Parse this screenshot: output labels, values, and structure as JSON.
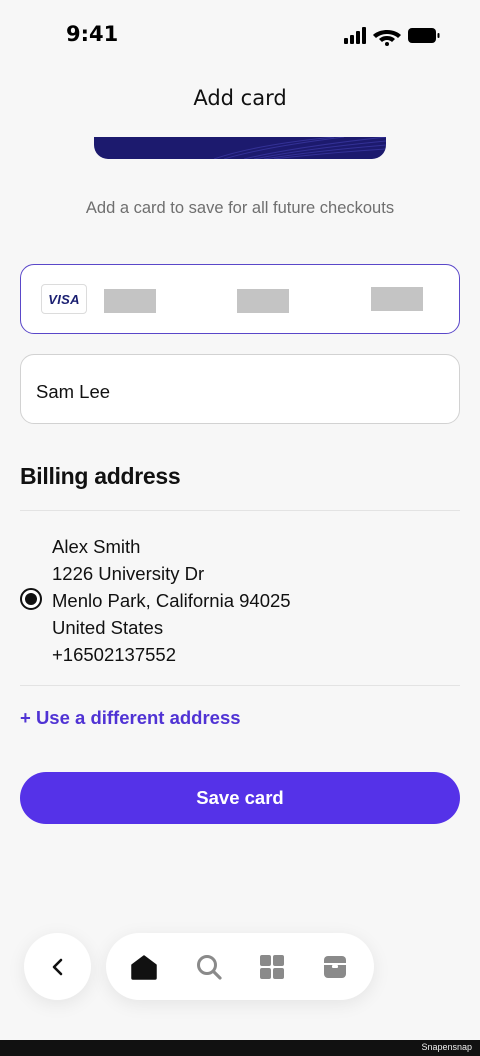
{
  "status_bar": {
    "time": "9:41"
  },
  "header": {
    "title": "Add card"
  },
  "subtitle": "Add a card to save for all future checkouts",
  "card_field": {
    "brand": "VISA"
  },
  "name_field": {
    "value": "Sam Lee"
  },
  "billing": {
    "title": "Billing address",
    "address_lines": [
      "Alex Smith",
      "1226 University Dr",
      "Menlo Park, California 94025",
      "United States",
      "+16502137552"
    ],
    "use_different_label": "+ Use a different address"
  },
  "save_button": {
    "label": "Save card"
  },
  "tab_bar": {
    "tabs": [
      "home-icon",
      "search-icon",
      "grid-icon",
      "box-icon"
    ],
    "active": "home-icon"
  },
  "footer": {
    "watermark": "Snapensnap"
  },
  "colors": {
    "accent": "#5532e8",
    "link": "#5033d4",
    "card": "#1c1a6e",
    "focus_border": "#5a47c9"
  }
}
